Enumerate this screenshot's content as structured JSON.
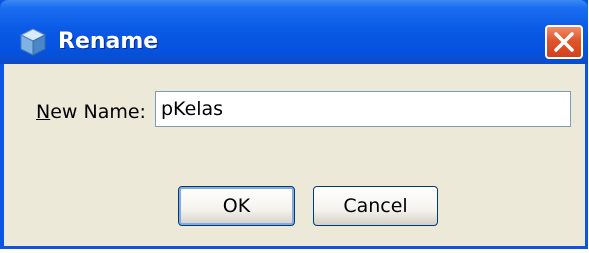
{
  "window": {
    "title": "Rename",
    "icon": "cube-icon",
    "close_icon": "close-icon"
  },
  "form": {
    "label": "New Name:",
    "label_mnemonic": "N",
    "label_rest": "ew Name:",
    "name_value": "pKelas"
  },
  "buttons": {
    "ok": "OK",
    "cancel": "Cancel"
  },
  "colors": {
    "titlebar": "#0a55e3",
    "close_button": "#d2411e",
    "dialog_body": "#ece9d8"
  }
}
